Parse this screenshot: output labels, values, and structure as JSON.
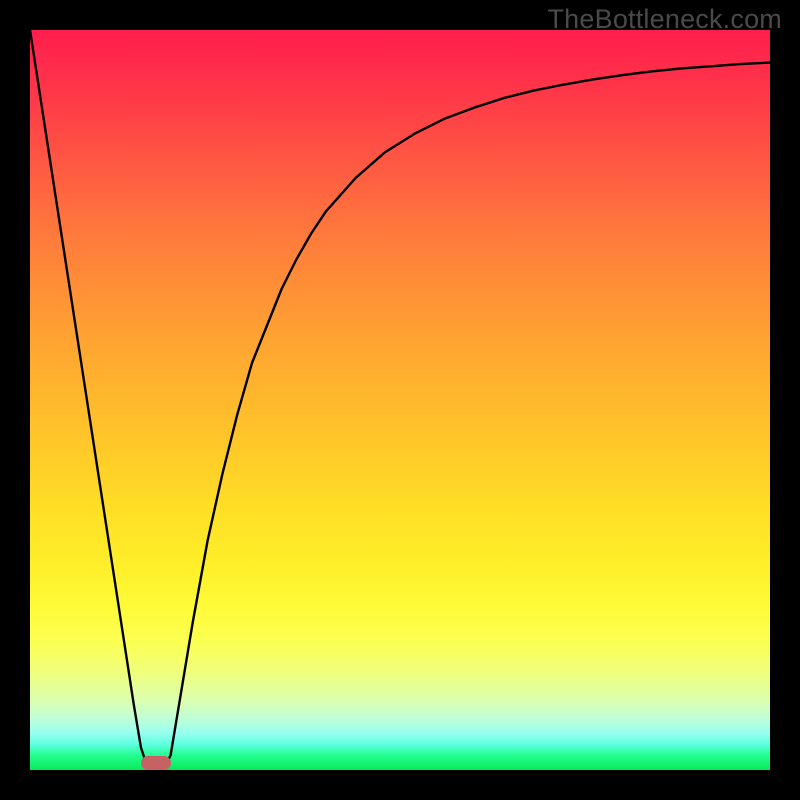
{
  "watermark": "TheBottleneck.com",
  "chart_data": {
    "type": "line",
    "title": "",
    "xlabel": "",
    "ylabel": "",
    "xlim": [
      0,
      100
    ],
    "ylim": [
      0,
      100
    ],
    "x": [
      0,
      2,
      4,
      6,
      8,
      10,
      12,
      14,
      15,
      16,
      17,
      18,
      19,
      20,
      22,
      24,
      26,
      28,
      30,
      32,
      34,
      36,
      38,
      40,
      44,
      48,
      52,
      56,
      60,
      64,
      68,
      72,
      76,
      80,
      84,
      88,
      92,
      96,
      100
    ],
    "values": [
      100,
      87,
      74,
      61,
      48,
      35,
      22,
      9,
      3,
      0,
      0,
      0,
      2,
      8,
      20,
      31,
      40,
      48,
      55,
      60,
      65,
      69,
      72.5,
      75.5,
      80,
      83.5,
      86,
      88,
      89.5,
      90.8,
      91.8,
      92.6,
      93.3,
      93.9,
      94.4,
      94.8,
      95.1,
      95.4,
      95.6
    ],
    "optimal_range_x": [
      15,
      19
    ],
    "optimal_value": 0,
    "marker_color": "#c76264",
    "gradient": {
      "top": "#ff1e4d",
      "mid": "#ffcd28",
      "bottom": "#09e85b"
    }
  }
}
